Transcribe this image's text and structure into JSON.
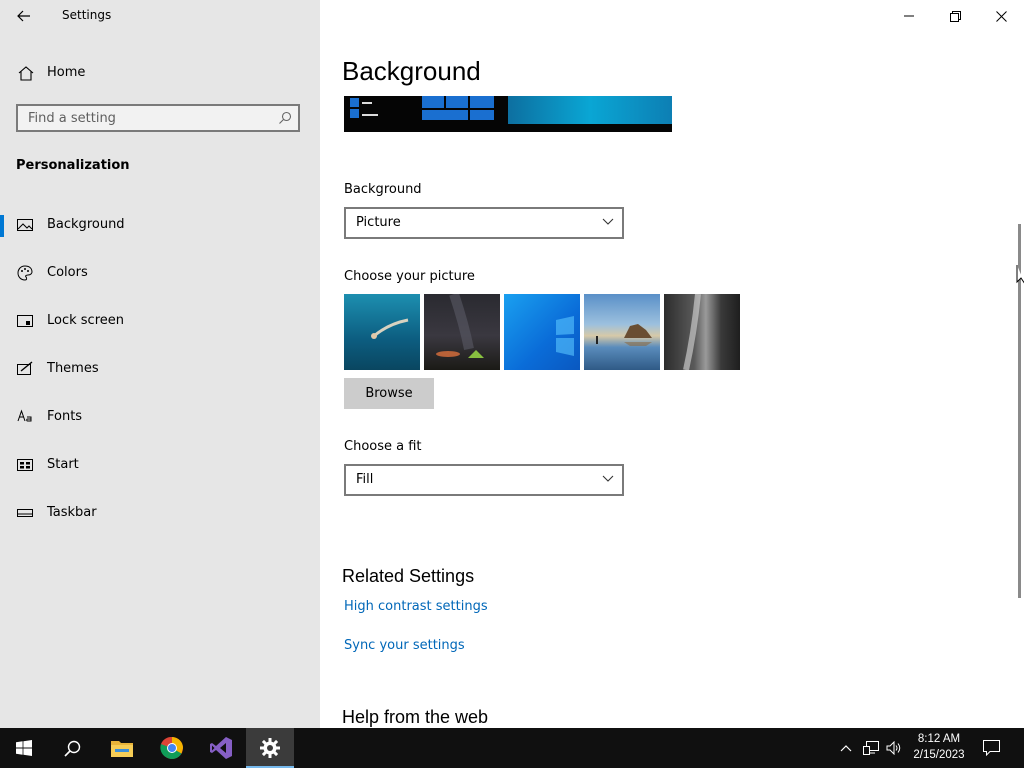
{
  "window": {
    "app_title": "Settings",
    "icons": {
      "back": "back-arrow-icon",
      "minimize": "minimize-icon",
      "restore": "restore-icon",
      "close": "close-icon"
    }
  },
  "sidebar": {
    "home_label": "Home",
    "search_placeholder": "Find a setting",
    "section_title": "Personalization",
    "items": [
      {
        "label": "Background",
        "icon": "picture-icon",
        "active": true
      },
      {
        "label": "Colors",
        "icon": "palette-icon",
        "active": false
      },
      {
        "label": "Lock screen",
        "icon": "lock-screen-icon",
        "active": false
      },
      {
        "label": "Themes",
        "icon": "themes-icon",
        "active": false
      },
      {
        "label": "Fonts",
        "icon": "fonts-icon",
        "active": false
      },
      {
        "label": "Start",
        "icon": "start-icon",
        "active": false
      },
      {
        "label": "Taskbar",
        "icon": "taskbar-icon",
        "active": false
      }
    ]
  },
  "main": {
    "title": "Background",
    "background_label": "Background",
    "background_value": "Picture",
    "choose_picture_label": "Choose your picture",
    "thumbnails": [
      "underwater-swimmer",
      "night-sky-tent",
      "windows-blue",
      "beach-rocks",
      "waterfall-rock"
    ],
    "browse_label": "Browse",
    "fit_label": "Choose a fit",
    "fit_value": "Fill",
    "related_title": "Related Settings",
    "related_links": [
      "High contrast settings",
      "Sync your settings"
    ],
    "help_title": "Help from the web",
    "accent_color": "#0067b8"
  },
  "taskbar": {
    "apps": [
      "start-icon",
      "search-icon",
      "file-explorer-icon",
      "chrome-icon",
      "visual-studio-icon",
      "settings-icon"
    ],
    "active_app": "settings-icon",
    "time": "8:12 AM",
    "date": "2/15/2023"
  }
}
